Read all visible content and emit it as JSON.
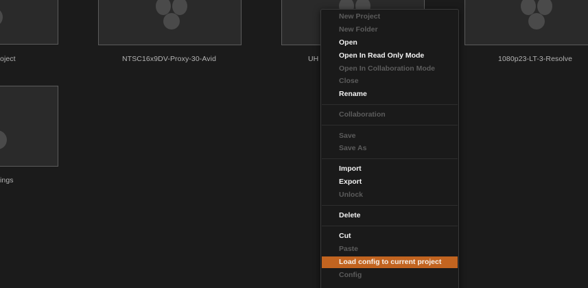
{
  "projects": [
    {
      "name": "oject"
    },
    {
      "name": "NTSC16x9DV-Proxy-30-Avid"
    },
    {
      "name": "UH"
    },
    {
      "name": "1080p23-LT-3-Resolve"
    },
    {
      "name": "ings"
    }
  ],
  "context_menu": {
    "items": [
      {
        "label": "New Project",
        "enabled": false
      },
      {
        "label": "New Folder",
        "enabled": false
      },
      {
        "label": "Open",
        "enabled": true
      },
      {
        "label": "Open In Read Only Mode",
        "enabled": true
      },
      {
        "label": "Open In Collaboration Mode",
        "enabled": false
      },
      {
        "label": "Close",
        "enabled": false
      },
      {
        "label": "Rename",
        "enabled": true
      },
      {
        "label": "Collaboration",
        "enabled": false
      },
      {
        "label": "Save",
        "enabled": false
      },
      {
        "label": "Save As",
        "enabled": false
      },
      {
        "label": "Import",
        "enabled": true
      },
      {
        "label": "Export",
        "enabled": true
      },
      {
        "label": "Unlock",
        "enabled": false
      },
      {
        "label": "Delete",
        "enabled": true
      },
      {
        "label": "Cut",
        "enabled": true
      },
      {
        "label": "Paste",
        "enabled": false
      },
      {
        "label": "Load config to current project",
        "enabled": true,
        "selected": true
      },
      {
        "label": "Config",
        "enabled": false
      }
    ]
  },
  "colors": {
    "background": "#1b1b1b",
    "thumbnail_border": "#5c5c5c",
    "menu_highlight": "#c26420",
    "enabled_text": "#f2f2f2",
    "disabled_text": "#5c5c5c"
  },
  "icons": {
    "thumbnail_placeholder": "resolve-logo-icon"
  }
}
